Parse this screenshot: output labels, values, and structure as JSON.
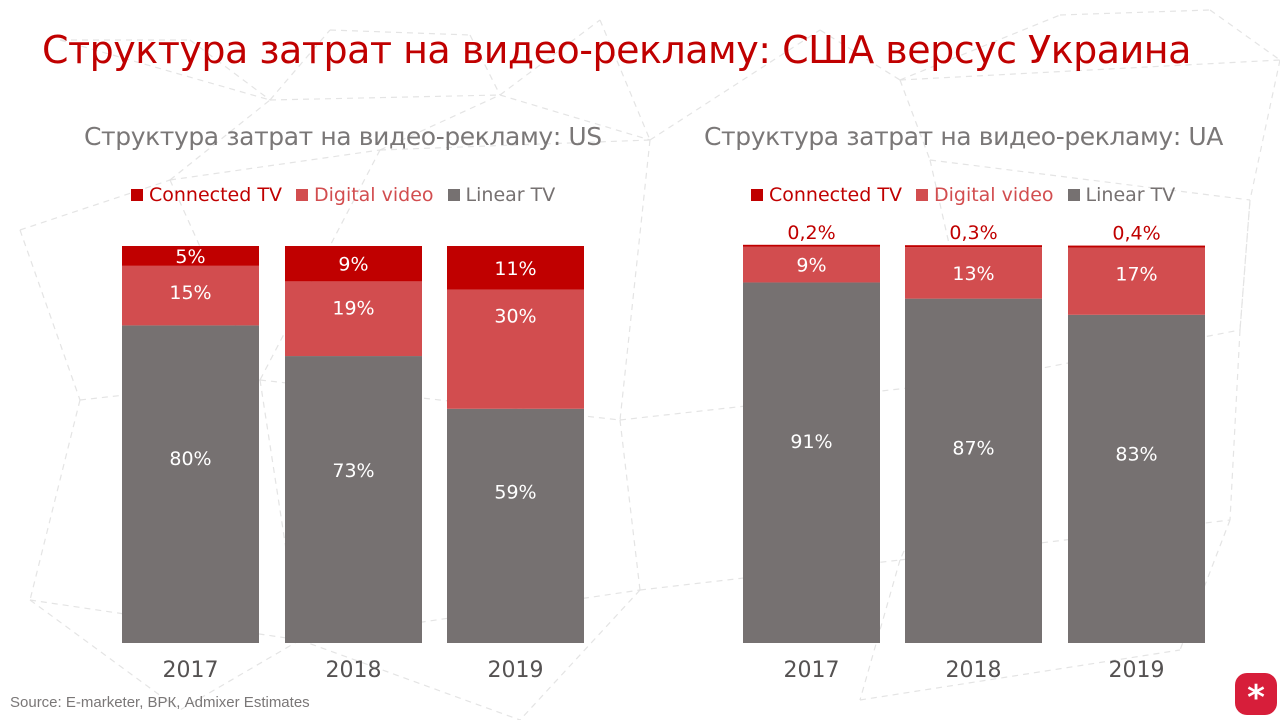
{
  "page": {
    "title": "Структура затрат на видео-рекламу: США версус Украина",
    "source": "Source: E-marketer, ВРК, Admixer Estimates",
    "logo_icon": "asterisk-icon",
    "colors": {
      "title": "#c00000",
      "connected_tv": "#c00000",
      "digital_video": "#d24d4f",
      "linear_tv": "#767171",
      "subtitle": "#7a7777",
      "logo": "#d71e3a"
    }
  },
  "chart_data": [
    {
      "type": "bar",
      "stacked": true,
      "normalized": true,
      "title": "Структура затрат на видео-рекламу: US",
      "legend_position": "top",
      "categories": [
        "2017",
        "2018",
        "2019"
      ],
      "series": [
        {
          "name": "Connected TV",
          "values": [
            5,
            9,
            11
          ],
          "labels": [
            "5%",
            "9%",
            "11%"
          ]
        },
        {
          "name": "Digital video",
          "values": [
            15,
            19,
            30
          ],
          "labels": [
            "15%",
            "19%",
            "30%"
          ]
        },
        {
          "name": "Linear TV",
          "values": [
            80,
            73,
            59
          ],
          "labels": [
            "80%",
            "73%",
            "59%"
          ]
        }
      ],
      "xlabel": "",
      "ylabel": "",
      "ylim": [
        0,
        100
      ],
      "grid": false
    },
    {
      "type": "bar",
      "stacked": true,
      "normalized": true,
      "title": "Структура затрат на видео-рекламу: UA",
      "legend_position": "top",
      "categories": [
        "2017",
        "2018",
        "2019"
      ],
      "series": [
        {
          "name": "Connected TV",
          "values": [
            0.2,
            0.3,
            0.4
          ],
          "labels": [
            "0,2%",
            "0,3%",
            "0,4%"
          ],
          "label_position": "above"
        },
        {
          "name": "Digital video",
          "values": [
            9,
            13,
            17
          ],
          "labels": [
            "9%",
            "13%",
            "17%"
          ]
        },
        {
          "name": "Linear TV",
          "values": [
            91,
            87,
            83
          ],
          "labels": [
            "91%",
            "87%",
            "83%"
          ]
        }
      ],
      "xlabel": "",
      "ylabel": "",
      "ylim": [
        0,
        100
      ],
      "grid": false
    }
  ]
}
